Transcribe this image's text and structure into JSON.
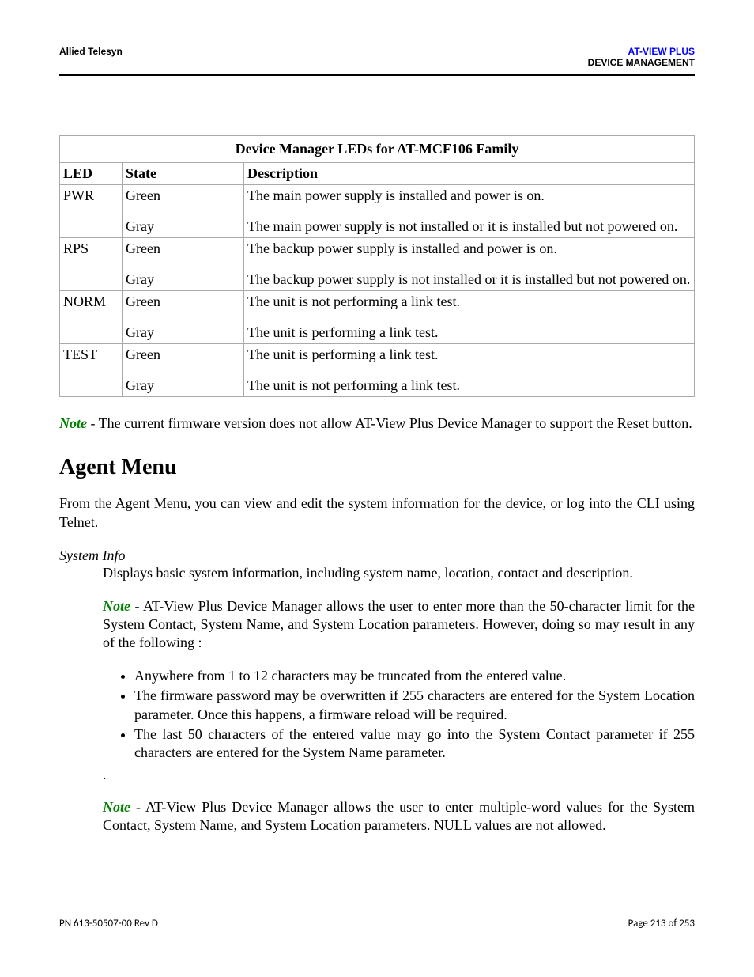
{
  "header": {
    "left": "Allied Telesyn",
    "right_line1": "AT-VIEW PLUS",
    "right_line2": "DEVICE MANAGEMENT"
  },
  "table": {
    "title": "Device Manager LEDs for AT-MCF106 Family",
    "columns": {
      "c0": "LED",
      "c1": "State",
      "c2": "Description"
    },
    "rows": [
      {
        "led": "PWR",
        "states": {
          "s0": "Green",
          "s1": "Gray"
        },
        "descs": {
          "d0": "The main power supply is installed and power is on.",
          "d1": "The main power supply is not installed or it is installed but not powered on."
        }
      },
      {
        "led": "RPS",
        "states": {
          "s0": "Green",
          "s1": "Gray"
        },
        "descs": {
          "d0": "The backup power supply is installed and power is on.",
          "d1": "The backup power supply is not installed or it is installed but not powered on."
        }
      },
      {
        "led": "NORM",
        "states": {
          "s0": "Green",
          "s1": "Gray"
        },
        "descs": {
          "d0": "The unit is not performing a link test.",
          "d1": "The unit is performing a link test."
        }
      },
      {
        "led": "TEST",
        "states": {
          "s0": "Green",
          "s1": "Gray"
        },
        "descs": {
          "d0": "The unit is performing a link test.",
          "d1": "The unit is not performing a link test."
        }
      }
    ]
  },
  "note1": {
    "label": "Note",
    "text": " - The current firmware version does not allow AT-View Plus Device Manager to support the Reset button."
  },
  "section_heading": "Agent Menu",
  "section_intro": "From the Agent Menu, you can view and edit the system information for the device, or log into the CLI using Telnet.",
  "sysinfo": {
    "heading": "System Info",
    "desc": "Displays basic system information, including system name, location, contact and description.",
    "note2_label": "Note",
    "note2_text": " - AT-View Plus Device Manager allows the user to enter more than the 50-character limit for the System Contact, System Name, and System Location parameters. However, doing so may result in any of the following :",
    "bullets": {
      "b0": "Anywhere from 1 to 12 characters may be truncated from the entered value.",
      "b1": "The firmware password may be overwritten if 255 characters are entered for the System Location parameter. Once this happens, a firmware reload will be required.",
      "b2": "The last 50 characters of the entered value may go into the System Contact parameter if 255 characters are entered for the System Name parameter."
    },
    "dot": ".",
    "note3_label": "Note",
    "note3_text": " - AT-View Plus Device Manager allows the user to enter multiple-word values for the System Contact, System Name, and System Location parameters. NULL values are not allowed."
  },
  "footer": {
    "left": "PN 613-50507-00 Rev D",
    "right": "Page 213 of 253"
  }
}
